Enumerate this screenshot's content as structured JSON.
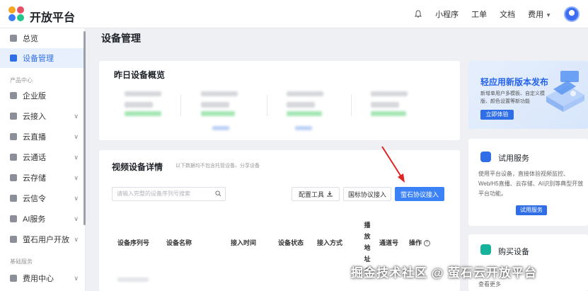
{
  "header": {
    "brand": "开放平台",
    "links": [
      "小程序",
      "工单",
      "文档",
      "费用"
    ]
  },
  "sidebar": {
    "items": [
      {
        "label": "总览",
        "active": false
      },
      {
        "label": "设备管理",
        "active": true
      }
    ],
    "group1": "产品中心",
    "products": [
      {
        "label": "企业版",
        "arrow": false
      },
      {
        "label": "云接入",
        "arrow": true
      },
      {
        "label": "云直播",
        "arrow": true
      },
      {
        "label": "云通话",
        "arrow": true
      },
      {
        "label": "云存储",
        "arrow": true
      },
      {
        "label": "云信令",
        "arrow": true
      },
      {
        "label": "AI服务",
        "arrow": true
      },
      {
        "label": "萤石用户开放",
        "arrow": true
      }
    ],
    "group2": "基础服务",
    "services": [
      {
        "label": "费用中心",
        "arrow": true
      }
    ]
  },
  "main": {
    "title": "设备管理",
    "overview": {
      "title": "昨日设备概览"
    },
    "details": {
      "title": "视频设备详情",
      "note": "以下数据均不包含托管设备、分享设备",
      "search_placeholder": "请输入完整的设备序列号搜索",
      "btn_config": "配置工具",
      "btn_gb": "国标协议接入",
      "btn_ys": "萤石协议接入",
      "columns": [
        "设备序列号",
        "设备名称",
        "接入时间",
        "设备状态",
        "接入方式"
      ],
      "col_stream": "播放地址",
      "col_channel": "通道号",
      "col_action": "操作"
    }
  },
  "right": {
    "promo": {
      "title": "轻应用新版本发布",
      "desc": "新增单用户多模板、自定义模版、颜色设置等新功能",
      "button": "立即体验"
    },
    "trial": {
      "title": "试用服务",
      "desc": "使用平台设备，直接体验视频监控、Web/H5直播、云存储、AI识别等典型开放平台功能。",
      "button": "试用服务"
    },
    "buy": {
      "title": "购买设备",
      "desc": "查看更多"
    }
  },
  "watermark": "掘金技术社区 @ 萤石云开放平台"
}
